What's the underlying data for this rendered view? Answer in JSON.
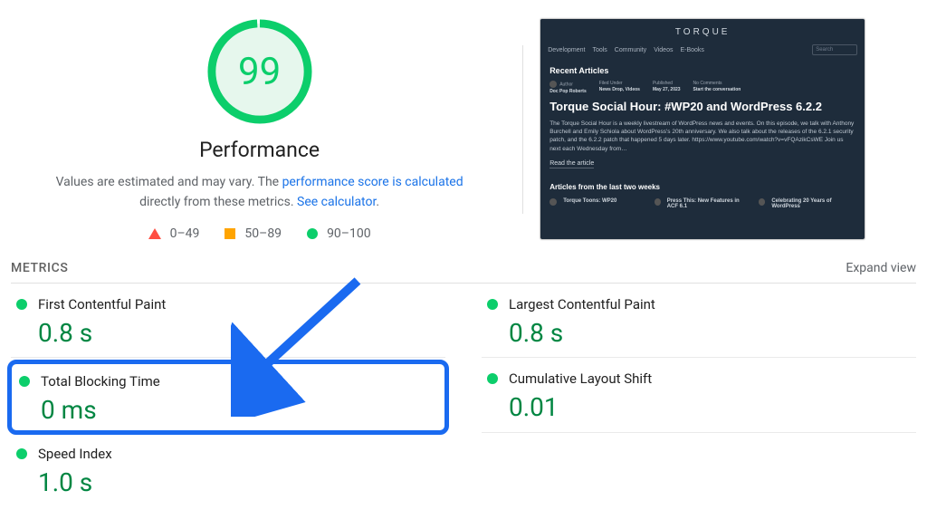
{
  "score": {
    "value": "99",
    "label": "Performance",
    "color": "#0cce6b",
    "bg": "#e6f7ed"
  },
  "description": {
    "pre": "Values are estimated and may vary. The ",
    "link1": "performance score is calculated",
    "mid": " directly from these metrics. ",
    "link2": "See calculator",
    "post": "."
  },
  "legend": {
    "fail": "0–49",
    "avg": "50–89",
    "pass": "90–100"
  },
  "preview": {
    "logo": "TORQUE",
    "nav": [
      "Development",
      "Tools",
      "Community",
      "Videos",
      "E-Books"
    ],
    "search_placeholder": "Search",
    "section": "Recent Articles",
    "meta_author_label": "Author",
    "meta_author": "Doc Pop Roberts",
    "meta_filed_label": "Filed Under",
    "meta_filed": "News Drop, Videos",
    "meta_pub_label": "Published",
    "meta_pub": "May 27, 2023",
    "meta_comments_label": "No Comments",
    "meta_comments": "Start the conversation",
    "article_title": "Torque Social Hour: #WP20 and WordPress 6.2.2",
    "article_body": "The Torque Social Hour is a weekly livestream of WordPress news and events. On this episode, we talk with Anthony Burchell and Emily Schiola about WordPress's 20th anniversary. We also talk about the releases of the 6.2.1 security patch, and the 6.2.2 patch that happened 5 days later. https://www.youtube.com/watch?v=vFQAzikCsWE Join us next each Wednesday from…",
    "read_link": "Read the article",
    "subsection": "Articles from the last two weeks",
    "cards": [
      "Torque Toons: WP20",
      "Press This: New Features in ACF 6.1",
      "Celebrating 20 Years of WordPress"
    ]
  },
  "metrics_header": "METRICS",
  "expand": "Expand view",
  "metrics": {
    "fcp": {
      "name": "First Contentful Paint",
      "value": "0.8 s"
    },
    "lcp": {
      "name": "Largest Contentful Paint",
      "value": "0.8 s"
    },
    "tbt": {
      "name": "Total Blocking Time",
      "value": "0 ms"
    },
    "cls": {
      "name": "Cumulative Layout Shift",
      "value": "0.01"
    },
    "si": {
      "name": "Speed Index",
      "value": "1.0 s"
    }
  }
}
